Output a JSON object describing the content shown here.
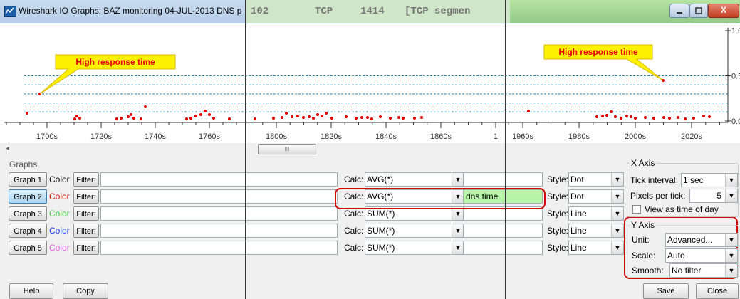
{
  "window": {
    "title": "Wireshark IO Graphs: BAZ monitoring 04-JUL-2013 DNS p",
    "background_glimpse": [
      "102",
      "TCP",
      "1414",
      "[TCP segmen"
    ],
    "min_icon": "minimize-icon",
    "max_icon": "maximize-icon",
    "close_glyph": "X"
  },
  "plot": {
    "y_ticks_right": [
      "1.0",
      "0.5",
      "0.0"
    ],
    "panels": [
      {
        "x_ticks": [
          "1700s",
          "1720s",
          "1740s",
          "1760s"
        ]
      },
      {
        "x_ticks": [
          "1800s",
          "1820s",
          "1840s",
          "1860s",
          "1"
        ]
      },
      {
        "x_ticks": [
          "1960s",
          "1980s",
          "2000s",
          "2020s"
        ]
      }
    ],
    "callouts": [
      "High response time",
      "High response time"
    ],
    "callout_color": "#fff200",
    "callout_text_color": "#e8000b",
    "point_color": "#e00000",
    "grid_color": "#2a8aa7",
    "scroll_thumb": "III"
  },
  "graphs": {
    "label": "Graphs",
    "rows": [
      {
        "button": "Graph 1",
        "color_label": "Color",
        "color": "#000000",
        "filter_label": "Filter:",
        "filter_value": "",
        "calc_label": "Calc:",
        "calc": "AVG(*)",
        "field": "",
        "style_label": "Style:",
        "style": "Dot",
        "active": false
      },
      {
        "button": "Graph 2",
        "color_label": "Color",
        "color": "#e00000",
        "filter_label": "Filter:",
        "filter_value": "",
        "calc_label": "Calc:",
        "calc": "AVG(*)",
        "field": "dns.time",
        "style_label": "Style:",
        "style": "Dot",
        "active": true
      },
      {
        "button": "Graph 3",
        "color_label": "Color",
        "color": "#3cc63c",
        "filter_label": "Filter:",
        "filter_value": "",
        "calc_label": "Calc:",
        "calc": "SUM(*)",
        "field": "",
        "style_label": "Style:",
        "style": "Line",
        "active": false
      },
      {
        "button": "Graph 4",
        "color_label": "Color",
        "color": "#1e3cff",
        "filter_label": "Filter:",
        "filter_value": "",
        "calc_label": "Calc:",
        "calc": "SUM(*)",
        "field": "",
        "style_label": "Style:",
        "style": "Line",
        "active": false
      },
      {
        "button": "Graph 5",
        "color_label": "Color",
        "color": "#e85ce0",
        "filter_label": "Filter:",
        "filter_value": "",
        "calc_label": "Calc:",
        "calc": "SUM(*)",
        "field": "",
        "style_label": "Style:",
        "style": "Line",
        "active": false
      }
    ]
  },
  "x_axis": {
    "label": "X Axis",
    "tick_interval_label": "Tick interval:",
    "tick_interval": "1 sec",
    "pixels_per_tick_label": "Pixels per tick:",
    "pixels_per_tick": "5",
    "view_time_of_day_label": "View as time of day",
    "view_time_of_day_checked": false
  },
  "y_axis": {
    "label": "Y Axis",
    "unit_label": "Unit:",
    "unit": "Advanced...",
    "scale_label": "Scale:",
    "scale": "Auto",
    "smooth_label": "Smooth:",
    "smooth": "No filter"
  },
  "footer": {
    "help": "Help",
    "copy": "Copy",
    "save": "Save",
    "close": "Close"
  },
  "highlight_color": "#d10a0a",
  "field_highlight_color": "#b7f5a8"
}
